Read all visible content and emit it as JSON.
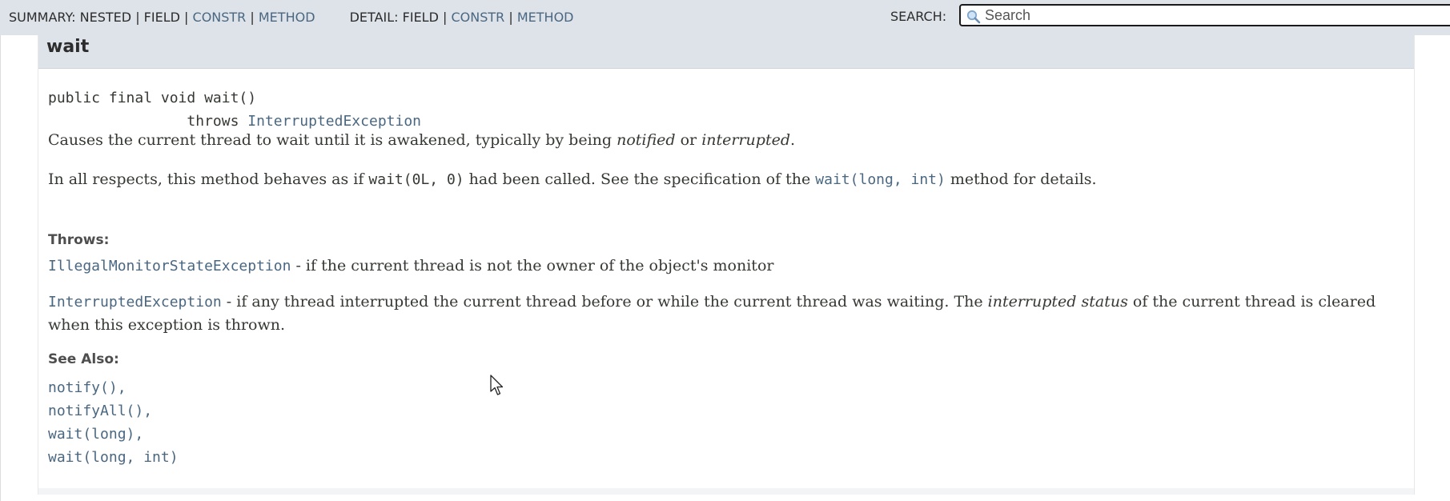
{
  "topbar": {
    "summary_label": "SUMMARY:",
    "summary_nested": "NESTED",
    "summary_field": "FIELD",
    "summary_constr": "CONSTR",
    "summary_method": "METHOD",
    "detail_label": "DETAIL:",
    "detail_field": "FIELD",
    "detail_constr": "CONSTR",
    "detail_method": "METHOD",
    "separator": "|",
    "search_label": "SEARCH:",
    "search_placeholder": "Search",
    "search_value": ""
  },
  "method": {
    "name": "wait",
    "signature_line1": "public final void wait()",
    "signature_throws_kw": "throws",
    "signature_throws_type": "InterruptedException",
    "desc1_part1": "Causes the current thread to wait until it is awakened, typically by being ",
    "desc1_em1": "notified",
    "desc1_mid": " or ",
    "desc1_em2": "interrupted",
    "desc1_end": ".",
    "desc2_part1": "In all respects, this method behaves as if ",
    "desc2_code": "wait(0L, 0)",
    "desc2_mid": " had been called. See the specification of the ",
    "desc2_link": "wait(long, int)",
    "desc2_end": " method for details.",
    "throws_label": "Throws:",
    "throws": [
      {
        "type": "IllegalMonitorStateException",
        "text": " - if the current thread is not the owner of the object's monitor"
      },
      {
        "type": "InterruptedException",
        "text_part1": " - if any thread interrupted the current thread before or while the current thread was waiting. The ",
        "text_em": "interrupted status",
        "text_part2": " of the current thread is cleared when this exception is thrown."
      }
    ],
    "see_also_label": "See Also:",
    "see_also": [
      "notify()",
      "notifyAll()",
      "wait(long)",
      "wait(long, int)"
    ],
    "see_also_separator": ","
  },
  "colors": {
    "link": "#4a6782",
    "header_bg": "#dee3e9",
    "text": "#353833"
  },
  "icons": {
    "search": "magnifier-icon",
    "cursor": "mouse-pointer-icon"
  }
}
